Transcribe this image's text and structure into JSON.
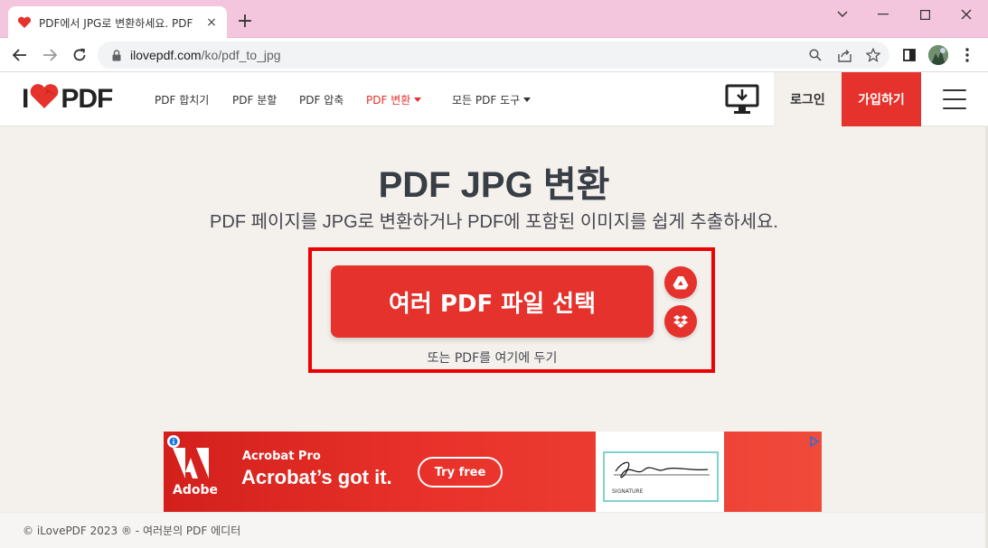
{
  "browser": {
    "tab_title": "PDF에서 JPG로 변환하세요. PDF",
    "tab_close": "×",
    "new_tab": "+",
    "url_host": "ilovepdf.com",
    "url_path": "/ko/pdf_to_jpg"
  },
  "site": {
    "logo_left": "I",
    "logo_right": "PDF",
    "nav": [
      {
        "label": "PDF 합치기",
        "active": false
      },
      {
        "label": "PDF 분할",
        "active": false
      },
      {
        "label": "PDF 압축",
        "active": false
      },
      {
        "label": "PDF 변환",
        "active": true
      },
      {
        "label": "모든 PDF 도구",
        "active": false
      }
    ],
    "login": "로그인",
    "signup": "가입하기"
  },
  "main": {
    "title": "PDF JPG 변환",
    "subtitle": "PDF 페이지를 JPG로 변환하거나 PDF에 포함된 이미지를 쉽게 추출하세요.",
    "select_button": "여러 PDF 파일 선택",
    "drop_text": "또는 PDF를 여기에 두기"
  },
  "ad": {
    "brand": "Adobe",
    "product": "Acrobat Pro",
    "headline": "Acrobat’s got it.",
    "cta": "Try free",
    "signature_label": "SIGNATURE"
  },
  "footer": {
    "text": "© iLovePDF 2023 ® - 여러분의 PDF 에디터"
  },
  "colors": {
    "brand_red": "#e5322d",
    "tab_strip": "#f3c6dd",
    "page_bg": "#f4f0ec"
  }
}
